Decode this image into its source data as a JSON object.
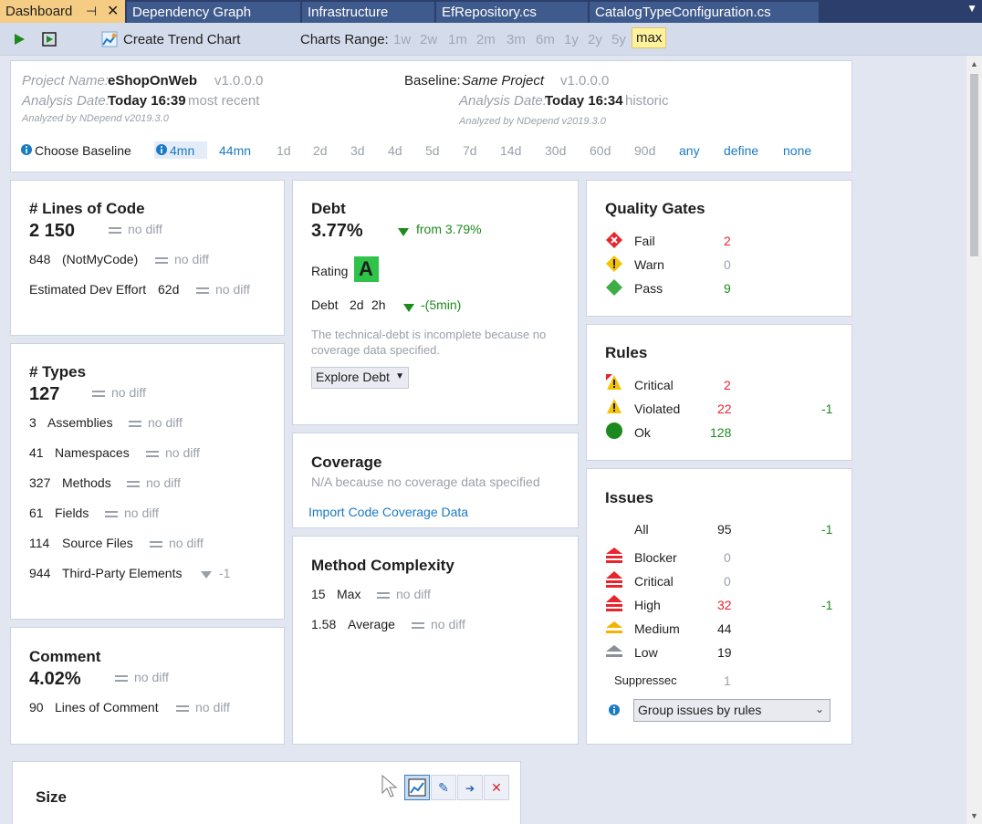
{
  "tabs": [
    {
      "label": "Dashboard",
      "active": true
    },
    {
      "label": "Dependency Graph"
    },
    {
      "label": "Infrastructure"
    },
    {
      "label": "EfRepository.cs"
    },
    {
      "label": "CatalogTypeConfiguration.cs"
    }
  ],
  "toolbar": {
    "create_trend_chart": "Create Trend Chart",
    "charts_range_label": "Charts Range:",
    "ranges": [
      "1w",
      "2w",
      "1m",
      "2m",
      "3m",
      "6m",
      "1y",
      "2y",
      "5y",
      "max"
    ],
    "active_range": "max"
  },
  "header": {
    "project_name_label": "Project Name:",
    "project_name": "eShopOnWeb",
    "project_version": "v1.0.0.0",
    "analysis_date_label": "Analysis Date:",
    "analysis_date": "Today 16:39",
    "analysis_date_note": "most recent",
    "analyzed_by": "Analyzed by NDepend v2019.3.0",
    "baseline_label": "Baseline:",
    "baseline_value": "Same Project",
    "baseline_version": "v1.0.0.0",
    "baseline_date_label": "Analysis Date:",
    "baseline_date": "Today 16:34",
    "baseline_date_note": "historic",
    "baseline_analyzed_by": "Analyzed by NDepend v2019.3.0",
    "choose_baseline": "Choose Baseline",
    "baseline_options": [
      "4mn",
      "44mn",
      "1d",
      "2d",
      "3d",
      "4d",
      "5d",
      "7d",
      "14d",
      "30d",
      "60d",
      "90d",
      "any",
      "define",
      "none"
    ],
    "selected_baseline": "4mn"
  },
  "loc": {
    "title": "# Lines of Code",
    "value": "2 150",
    "diff": "no diff",
    "notmycode_value": "848",
    "notmycode_label": "(NotMyCode)",
    "notmycode_diff": "no diff",
    "effort_label": "Estimated Dev Effort",
    "effort_value": "62d",
    "effort_diff": "no diff"
  },
  "types": {
    "title": "# Types",
    "value": "127",
    "diff": "no diff",
    "rows": [
      {
        "value": "3",
        "label": "Assemblies",
        "diff": "no diff"
      },
      {
        "value": "41",
        "label": "Namespaces",
        "diff": "no diff"
      },
      {
        "value": "327",
        "label": "Methods",
        "diff": "no diff"
      },
      {
        "value": "61",
        "label": "Fields",
        "diff": "no diff"
      },
      {
        "value": "114",
        "label": "Source Files",
        "diff": "no diff"
      },
      {
        "value": "944",
        "label": "Third-Party Elements",
        "diff": "-1"
      }
    ]
  },
  "comment": {
    "title": "Comment",
    "value": "4.02%",
    "diff": "no diff",
    "lines_value": "90",
    "lines_label": "Lines of Comment",
    "lines_diff": "no diff"
  },
  "debt": {
    "title": "Debt",
    "value": "3.77%",
    "from": "from 3.79%",
    "rating_label": "Rating",
    "rating": "A",
    "debt_label": "Debt",
    "debt_d": "2d",
    "debt_h": "2h",
    "debt_diff": "-(5min)",
    "note": "The technical-debt is incomplete because no coverage data specified.",
    "explore": "Explore Debt"
  },
  "coverage": {
    "title": "Coverage",
    "note": "N/A because no coverage data specified",
    "import": "Import Code Coverage Data"
  },
  "complexity": {
    "title": "Method Complexity",
    "max_value": "15",
    "max_label": "Max",
    "max_diff": "no diff",
    "avg_value": "1.58",
    "avg_label": "Average",
    "avg_diff": "no diff"
  },
  "quality_gates": {
    "title": "Quality Gates",
    "rows": [
      {
        "label": "Fail",
        "value": "2"
      },
      {
        "label": "Warn",
        "value": "0"
      },
      {
        "label": "Pass",
        "value": "9"
      }
    ]
  },
  "rules": {
    "title": "Rules",
    "rows": [
      {
        "label": "Critical",
        "value": "2",
        "diff": ""
      },
      {
        "label": "Violated",
        "value": "22",
        "diff": "-1"
      },
      {
        "label": "Ok",
        "value": "128",
        "diff": ""
      }
    ]
  },
  "issues": {
    "title": "Issues",
    "all_label": "All",
    "all_value": "95",
    "all_diff": "-1",
    "rows": [
      {
        "label": "Blocker",
        "value": "0",
        "diff": ""
      },
      {
        "label": "Critical",
        "value": "0",
        "diff": ""
      },
      {
        "label": "High",
        "value": "32",
        "diff": "-1"
      },
      {
        "label": "Medium",
        "value": "44",
        "diff": ""
      },
      {
        "label": "Low",
        "value": "19",
        "diff": ""
      }
    ],
    "suppressed_label": "Suppressec",
    "suppressed_value": "1",
    "group_by": "Group issues by rules"
  },
  "size_panel": {
    "title": "Size"
  },
  "colors": {
    "tab_bg": "#2c3e6b",
    "active_tab": "#f5cc84",
    "red": "#e8242c",
    "green": "#1d8a1d",
    "link": "#1a7ac4",
    "rating_bg": "#2fc34a"
  }
}
